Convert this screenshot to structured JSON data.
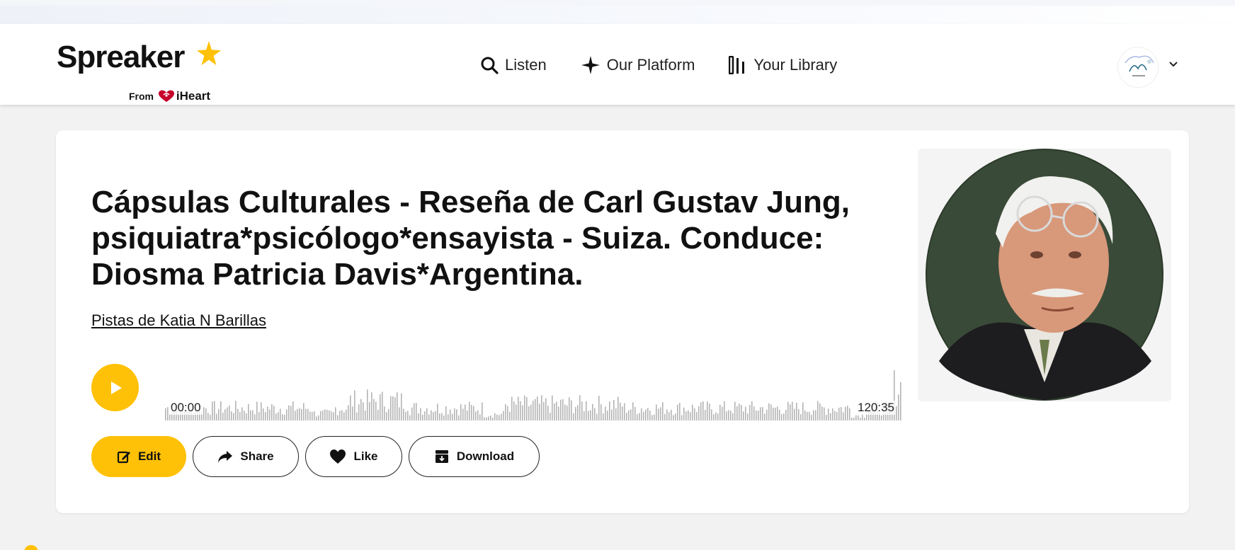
{
  "brand": {
    "wordmark": "Spreaker",
    "from": "From",
    "partner": "iHeart",
    "accent": "#ffc107",
    "partner_color": "#c6002b"
  },
  "nav": {
    "items": [
      {
        "label": "Listen",
        "icon": "search-icon"
      },
      {
        "label": "Our Platform",
        "icon": "sparkle-icon"
      },
      {
        "label": "Your Library",
        "icon": "library-icon"
      }
    ],
    "avatar_icon": "user-avatar",
    "menu_icon": "chevron-down-icon"
  },
  "episode": {
    "title": "Cápsulas Culturales - Reseña de Carl Gustav Jung, psiquiatra*psicólogo*ensayista - Suiza. Conduce: Diosma Patricia Davis*Argentina.",
    "author": "Pistas de Katia N Barillas",
    "cover_icon": "episode-cover-portrait"
  },
  "player": {
    "current_time": "00:00",
    "duration": "120:35",
    "progress": 0,
    "play_icon": "play-icon"
  },
  "actions": {
    "edit": "Edit",
    "share": "Share",
    "like": "Like",
    "download": "Download"
  }
}
